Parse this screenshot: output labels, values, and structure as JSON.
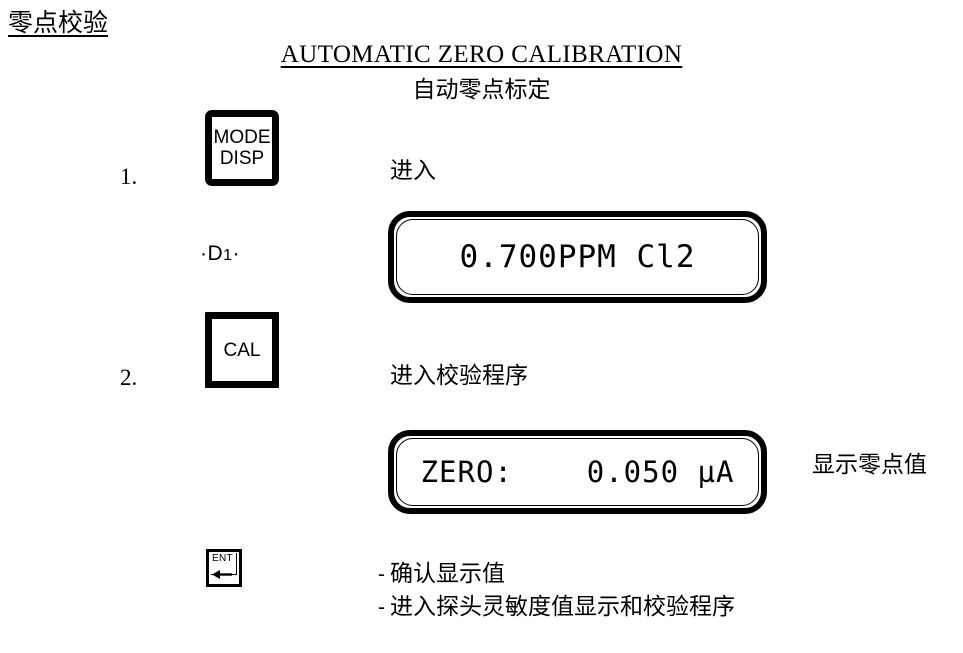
{
  "page": {
    "section_title": "零点校验",
    "main_title_en": "AUTOMATIC ZERO  CALIBRATION",
    "main_title_zh": "自动零点标定"
  },
  "steps": [
    {
      "number": "1.",
      "key_label_line1": "MODE",
      "key_label_line2": "DISP",
      "annotation": "进入",
      "sensor_label_prefix": "·D",
      "sensor_label_index": "1",
      "sensor_label_suffix": "·",
      "display": {
        "text": "0.700PPM Cl2"
      }
    },
    {
      "number": "2.",
      "key_label_line1": "CAL",
      "annotation": "进入校验程序",
      "display": {
        "text": "ZERO:    0.050 µA"
      },
      "display_side_note": "显示零点值"
    }
  ],
  "enter_key": {
    "label": "ENT",
    "icon": "enter-arrow-icon"
  },
  "bullets": [
    {
      "dash": "-",
      "text": "确认显示值"
    },
    {
      "dash": "-",
      "text": "进入探头灵敏度值显示和校验程序"
    }
  ],
  "colors": {
    "ink": "#000000",
    "background": "#ffffff"
  }
}
